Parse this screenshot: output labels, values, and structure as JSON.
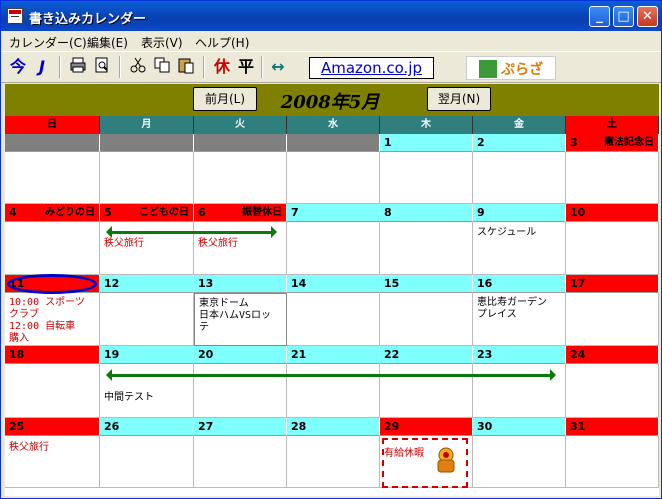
{
  "window": {
    "title": "書き込みカレンダー",
    "buttons": {
      "minimize": "_",
      "maximize": "□",
      "close": "✕"
    }
  },
  "menu": [
    "カレンダー(C)",
    "編集(E)",
    "表示(V)",
    "ヘルプ(H)"
  ],
  "toolbar": {
    "today": "今",
    "jump": "J",
    "holiday": "休",
    "weekday": "平",
    "link_text": "Amazon.co.jp",
    "logo_text": "ぷらざ"
  },
  "header": {
    "prev": "前月(L)",
    "next": "翌月(N)",
    "title": "2008年5月"
  },
  "colors": {
    "sunday": "#ff0000",
    "weekday_head": "#2f7f7f",
    "day_cell": "#80ffff",
    "grey_cell": "#808080",
    "header_bg": "#7f7f00"
  },
  "weekdays": [
    "日",
    "月",
    "火",
    "水",
    "木",
    "金",
    "土"
  ],
  "days": {
    "1": "1",
    "2": "2",
    "3": "3",
    "4": "4",
    "5": "5",
    "6": "6",
    "7": "7",
    "8": "8",
    "9": "9",
    "10": "10",
    "11": "11",
    "12": "12",
    "13": "13",
    "14": "14",
    "15": "15",
    "16": "16",
    "17": "17",
    "18": "18",
    "19": "19",
    "20": "20",
    "21": "21",
    "22": "22",
    "23": "23",
    "24": "24",
    "25": "25",
    "26": "26",
    "27": "27",
    "28": "28",
    "29": "29",
    "30": "30",
    "31": "31"
  },
  "holidays": {
    "d3": "憲法記念日",
    "d4": "みどりの日",
    "d5": "こどもの日",
    "d6": "振替休日"
  },
  "events": {
    "d5": "秩父旅行",
    "d6": "秩父旅行",
    "d9": "スケジュール",
    "d11": "10:00 スポーツ\nクラブ\n12:00  自転車\n購入",
    "d13": "東京ドーム\n日本ハムVSロッ\nテ",
    "d16": "恵比寿ガーデン\nプレイス",
    "d19": "中間テスト",
    "d25": "秩父旅行",
    "d29": "有給休暇"
  }
}
